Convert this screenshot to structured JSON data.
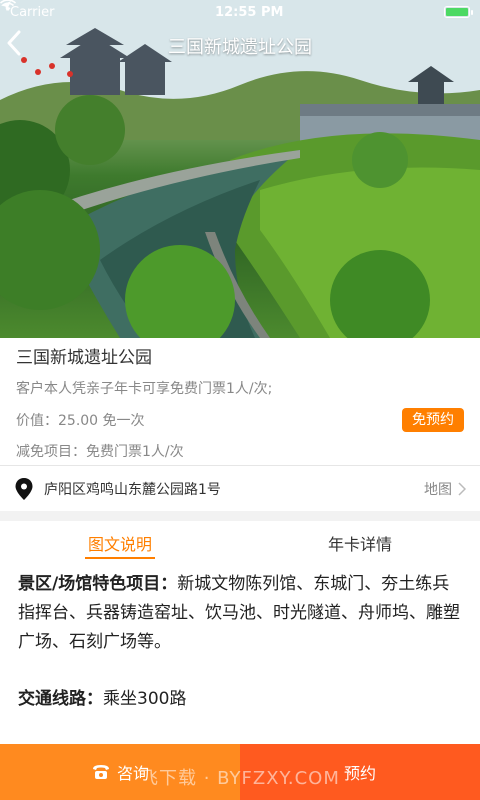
{
  "status_bar": {
    "carrier": "Carrier",
    "time": "12:55 PM"
  },
  "navbar": {
    "title": "三国新城遗址公园",
    "back_icon": "chevron-left-icon"
  },
  "info": {
    "title": "三国新城遗址公园",
    "description": "客户本人凭亲子年卡可享免费门票1人/次;",
    "price": "价值：25.00 免一次",
    "reserve_label": "免预约",
    "discount": "减免项目：免费门票1人/次"
  },
  "address": {
    "text": "庐阳区鸡鸣山东麓公园路1号",
    "map_label": "地图"
  },
  "tabs": [
    {
      "label": "图文说明",
      "active": true
    },
    {
      "label": "年卡详情",
      "active": false
    }
  ],
  "content": {
    "features_heading": "景区/场馆特色项目：",
    "features_text": "新城文物陈列馆、东城门、夯土练兵指挥台、兵器铸造窑址、饮马池、时光隧道、舟师坞、雕塑广场、石刻广场等。",
    "transport_heading": "交通线路：",
    "transport_text": "乘坐300路"
  },
  "bottom_bar": {
    "consult_label": "咨询",
    "book_label": "预约",
    "watermark": "飞下载 · BYFZXY.COM"
  },
  "colors": {
    "accent": "#ff7f00",
    "consult_bg": "#ff8a1f",
    "book_bg": "#ff5a1f"
  }
}
